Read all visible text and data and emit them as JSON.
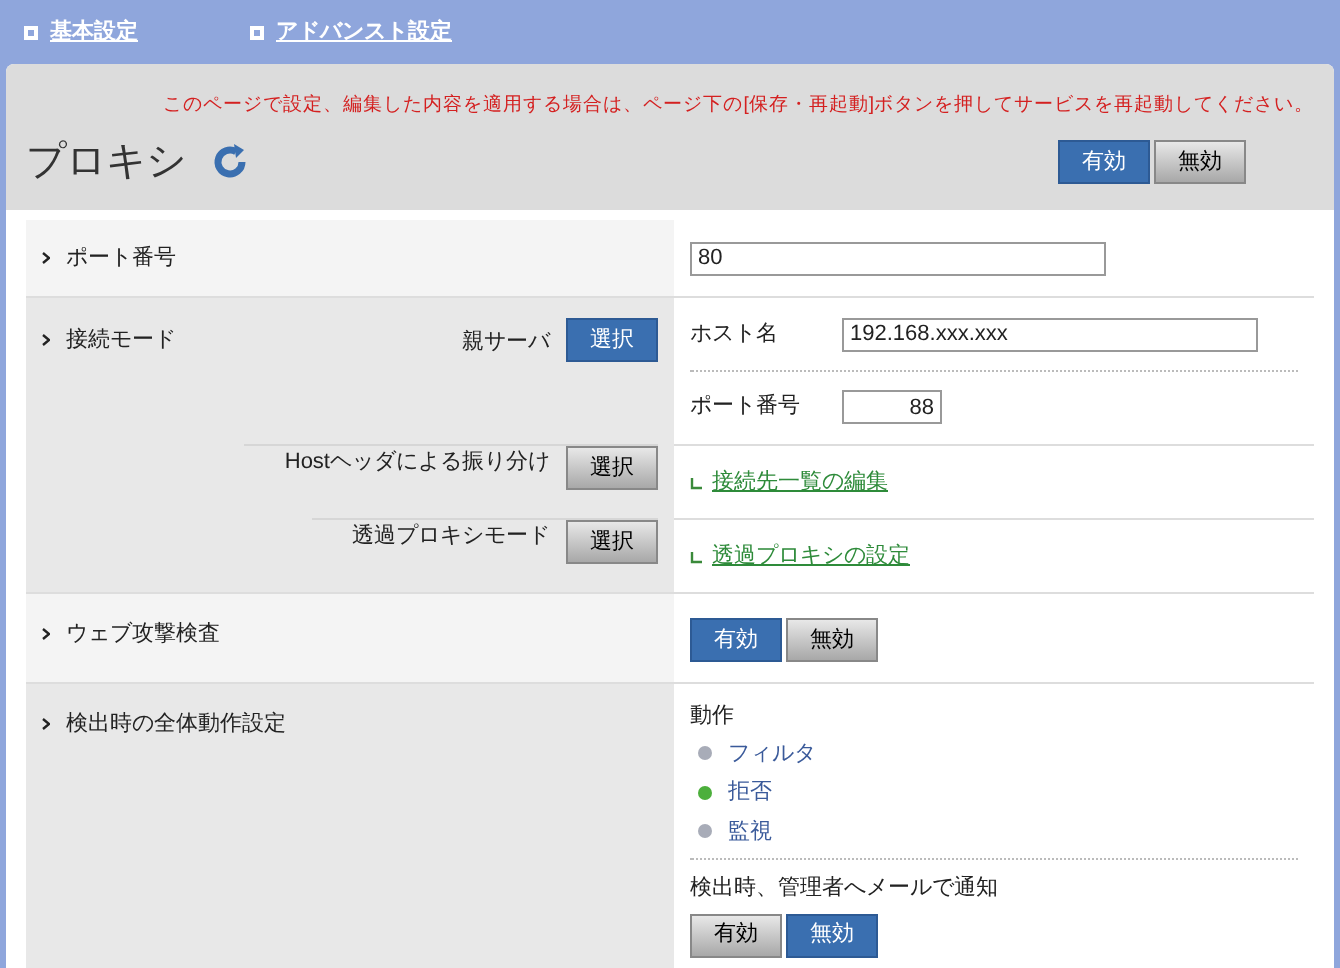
{
  "nav": [
    {
      "label": "基本設定"
    },
    {
      "label": "アドバンスト設定"
    }
  ],
  "notice": "このページで設定、編集した内容を適用する場合は、ページ下の[保存・再起動]ボタンを押してサービスを再起動してください。",
  "title": "プロキシ",
  "service_toggle": [
    {
      "label": "有効",
      "selected": true
    },
    {
      "label": "無効",
      "selected": false
    }
  ],
  "port": {
    "label": "ポート番号",
    "value": "80"
  },
  "connection_mode": {
    "label": "接続モード",
    "modes": [
      {
        "label": "親サーバ",
        "button": "選択",
        "selected": true,
        "fields": [
          {
            "label": "ホスト名",
            "value": "192.168.xxx.xxx",
            "kind": "wide"
          },
          {
            "label": "ポート番号",
            "value": "88",
            "kind": "narrow"
          }
        ]
      },
      {
        "label": "Hostヘッダによる振り分け",
        "button": "選択",
        "selected": false,
        "link": "接続先一覧の編集"
      },
      {
        "label": "透過プロキシモード",
        "button": "選択",
        "selected": false,
        "link": "透過プロキシの設定"
      }
    ]
  },
  "web_attack": {
    "label": "ウェブ攻撃検査",
    "toggle": [
      {
        "label": "有効",
        "selected": true
      },
      {
        "label": "無効",
        "selected": false
      }
    ]
  },
  "detection": {
    "label": "検出時の全体動作設定",
    "action_label": "動作",
    "actions": [
      {
        "label": "フィルタ",
        "selected": false
      },
      {
        "label": "拒否",
        "selected": true
      },
      {
        "label": "監視",
        "selected": false
      }
    ],
    "notify_label": "検出時、管理者へメールで通知",
    "notify_toggle": [
      {
        "label": "有効",
        "selected": false
      },
      {
        "label": "無効",
        "selected": true
      }
    ]
  }
}
